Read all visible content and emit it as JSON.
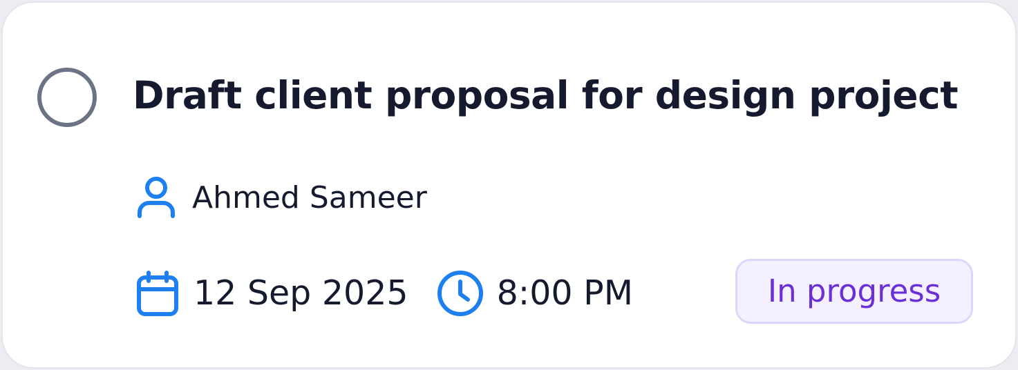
{
  "task": {
    "title": "Draft client proposal for design project",
    "assignee": {
      "name": "Ahmed Sameer",
      "icon": "user-icon"
    },
    "date": {
      "value": "12 Sep 2025",
      "icon": "calendar-icon"
    },
    "time": {
      "value": "8:00 PM",
      "icon": "clock-icon"
    },
    "status": {
      "label": "In progress",
      "text_color": "#6a2fd6",
      "background": "#f4f0ff",
      "border_color": "#ddd5fb"
    },
    "completed": false
  },
  "colors": {
    "icon_accent": "#1e7ff0",
    "text_primary": "#151a2e",
    "checkbox_border": "#6b7385"
  }
}
